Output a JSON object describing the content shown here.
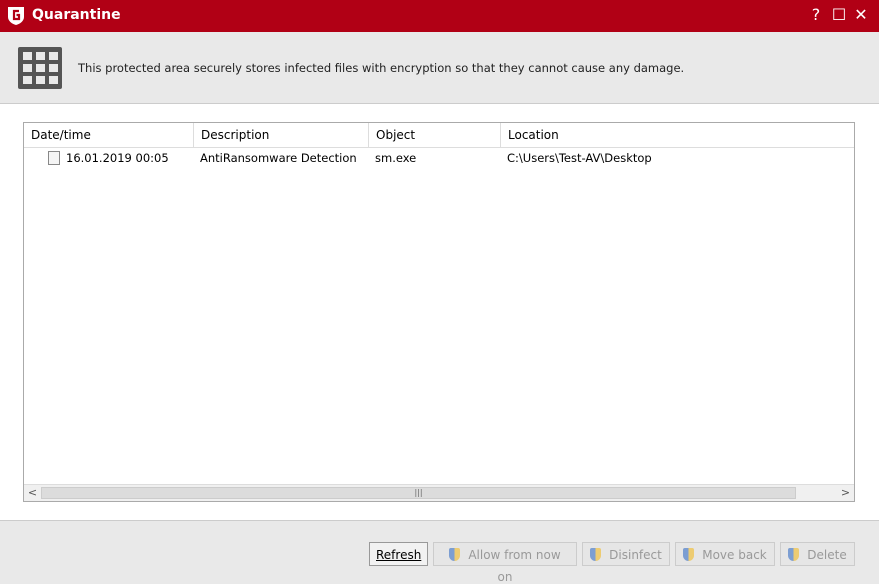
{
  "window": {
    "title": "Quarantine",
    "help": "?",
    "maximize": "☐",
    "close": "✕"
  },
  "header": {
    "description": "This protected area securely stores infected files with encryption so that they cannot cause any damage."
  },
  "table": {
    "columns": [
      "Date/time",
      "Description",
      "Object",
      "Location"
    ],
    "rows": [
      {
        "datetime": "16.01.2019 00:05",
        "description": "AntiRansomware Detection",
        "object": "sm.exe",
        "location": "C:\\Users\\Test-AV\\Desktop"
      }
    ]
  },
  "buttons": {
    "refresh": "Refresh",
    "allow": "Allow from now on",
    "disinfect": "Disinfect",
    "move_back": "Move back",
    "delete": "Delete"
  }
}
